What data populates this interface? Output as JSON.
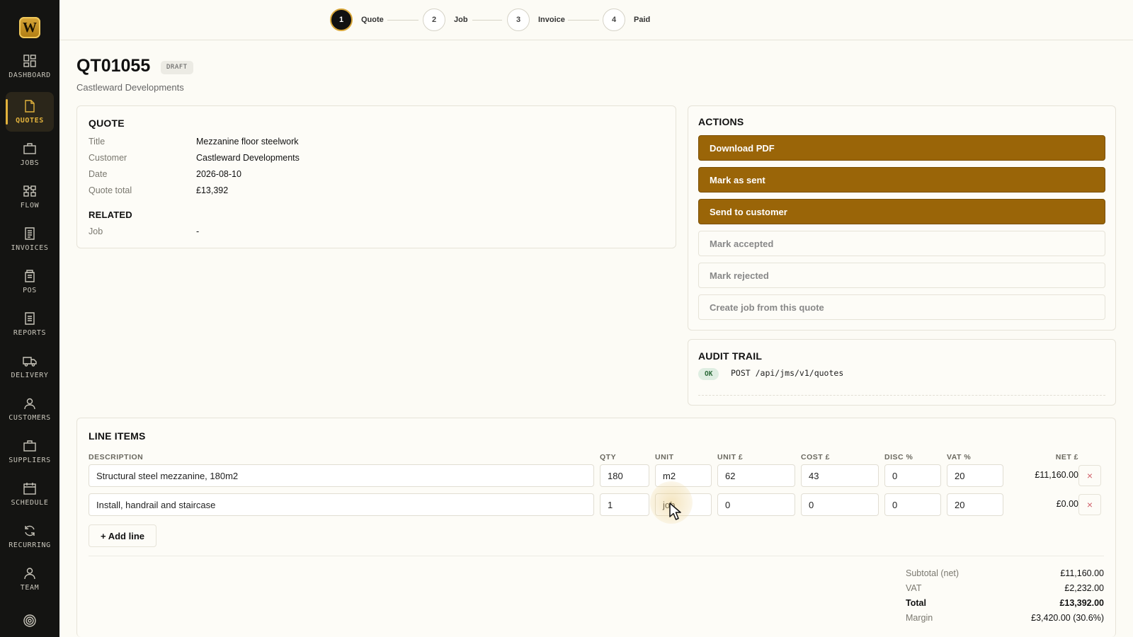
{
  "brand": {
    "logo_letter": "W"
  },
  "sidebar": {
    "items": [
      {
        "label": "DASHBOARD",
        "icon": "grid-icon",
        "active": false
      },
      {
        "label": "QUOTES",
        "icon": "document-icon",
        "active": true
      },
      {
        "label": "JOBS",
        "icon": "briefcase-icon",
        "active": false
      },
      {
        "label": "FLOW",
        "icon": "flow-icon",
        "active": false
      },
      {
        "label": "INVOICES",
        "icon": "invoice-icon",
        "active": false
      },
      {
        "label": "POS",
        "icon": "pos-icon",
        "active": false
      },
      {
        "label": "REPORTS",
        "icon": "report-icon",
        "active": false
      },
      {
        "label": "DELIVERY",
        "icon": "truck-icon",
        "active": false
      },
      {
        "label": "CUSTOMERS",
        "icon": "user-icon",
        "active": false
      },
      {
        "label": "SUPPLIERS",
        "icon": "briefcase-icon",
        "active": false
      },
      {
        "label": "SCHEDULE",
        "icon": "calendar-icon",
        "active": false
      },
      {
        "label": "RECURRING",
        "icon": "refresh-icon",
        "active": false
      },
      {
        "label": "TEAM",
        "icon": "team-icon",
        "active": false
      },
      {
        "label": "",
        "icon": "target-icon",
        "active": false
      }
    ]
  },
  "stepper": {
    "steps": [
      {
        "number": "1",
        "label": "Quote",
        "active": true
      },
      {
        "number": "2",
        "label": "Job",
        "active": false
      },
      {
        "number": "3",
        "label": "Invoice",
        "active": false
      },
      {
        "number": "4",
        "label": "Paid",
        "active": false
      }
    ]
  },
  "header": {
    "title": "QT01055",
    "status_badge": "DRAFT",
    "subtitle": "Castleward Developments"
  },
  "quote_card": {
    "heading": "QUOTE",
    "fields": [
      {
        "label": "Title",
        "value": "Mezzanine floor steelwork"
      },
      {
        "label": "Customer",
        "value": "Castleward Developments"
      },
      {
        "label": "Date",
        "value": "2026-08-10"
      },
      {
        "label": "Quote total",
        "value": "£13,392"
      }
    ],
    "related_heading": "RELATED",
    "related": [
      {
        "label": "Job",
        "value": "-"
      }
    ]
  },
  "actions": {
    "heading": "ACTIONS",
    "buttons": [
      {
        "label": "Download PDF",
        "style": "primary"
      },
      {
        "label": "Mark as sent",
        "style": "primary"
      },
      {
        "label": "Send to customer",
        "style": "primary"
      },
      {
        "label": "Mark accepted",
        "style": "secondary"
      },
      {
        "label": "Mark rejected",
        "style": "secondary"
      },
      {
        "label": "Create job from this quote",
        "style": "secondary"
      }
    ]
  },
  "audit": {
    "heading": "AUDIT TRAIL",
    "entries": [
      {
        "status": "OK",
        "text": "POST /api/jms/v1/quotes"
      }
    ]
  },
  "line_items": {
    "heading": "LINE ITEMS",
    "columns": {
      "description": "DESCRIPTION",
      "qty": "QTY",
      "unit": "UNIT",
      "unit_price": "UNIT £",
      "cost": "COST £",
      "disc": "DISC %",
      "vat": "VAT %",
      "net": "NET £"
    },
    "rows": [
      {
        "description": "Structural steel mezzanine, 180m2",
        "qty": "180",
        "unit": "m2",
        "unit_price": "62",
        "cost": "43",
        "disc": "0",
        "vat": "20",
        "net": "£11,160.00",
        "delete": "×"
      },
      {
        "description": "Install, handrail and staircase",
        "qty": "1",
        "unit": "job",
        "unit_price": "0",
        "cost": "0",
        "disc": "0",
        "vat": "20",
        "net": "£0.00",
        "delete": "×"
      }
    ],
    "add_line_label": "+ Add line",
    "totals": [
      {
        "label": "Subtotal (net)",
        "value": "£11,160.00",
        "bold": false
      },
      {
        "label": "VAT",
        "value": "£2,232.00",
        "bold": false
      },
      {
        "label": "Total",
        "value": "£13,392.00",
        "bold": true
      },
      {
        "label": "Margin",
        "value": "£3,420.00 (30.6%)",
        "bold": false
      }
    ]
  },
  "colors": {
    "sidebar_bg": "#141412",
    "accent": "#e2b23c",
    "primary_button": "#9a6508",
    "page_bg": "#fcfbf5",
    "ok_green": "#2c6b3a"
  }
}
